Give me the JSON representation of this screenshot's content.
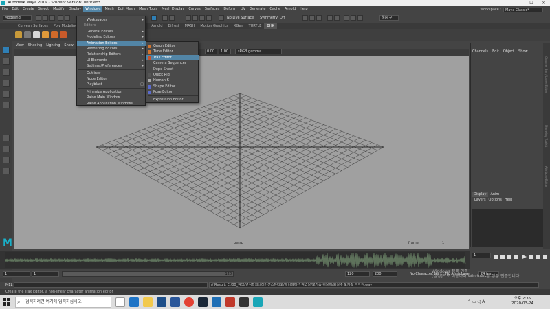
{
  "window": {
    "title": "Autodesk Maya 2019 - Student Version: untitled*",
    "buttons": [
      "—",
      "☐",
      "✕"
    ]
  },
  "menubar": {
    "items": [
      "File",
      "Edit",
      "Create",
      "Select",
      "Modify",
      "Display",
      "Windows",
      "Mesh",
      "Edit Mesh",
      "Mesh Tools",
      "Mesh Display",
      "Curves",
      "Surfaces",
      "Deform",
      "UV",
      "Generate",
      "Cache",
      "Arnold",
      "Help"
    ],
    "active": "Windows"
  },
  "workspace": {
    "label": "Workspace :",
    "value": "Maya Classic*"
  },
  "statusline": {
    "mode": "Modeling",
    "live_surface": "No Live Surface",
    "symmetry": "Symmetry: Off",
    "user": "해승 구"
  },
  "shelf": {
    "tabs": [
      "Curves / Surfaces",
      "Poly Modeling",
      "S",
      "g",
      "FX",
      "FX Caching",
      "Custom",
      "Arnold",
      "Bifrost",
      "MASH",
      "Motion Graphics",
      "XGen",
      "TURTLE",
      "BHK"
    ],
    "current": "BHK"
  },
  "viewport": {
    "menu": [
      "View",
      "Shading",
      "Lighting",
      "Show",
      "R"
    ],
    "gamma_values": [
      "0.00",
      "1.00"
    ],
    "color_space": "sRGB gamma",
    "camera_label": "persp",
    "frame_label": "frame",
    "frame_number": "1"
  },
  "channel_box": {
    "tabs": [
      "Channels",
      "Edit",
      "Object",
      "Show"
    ]
  },
  "layer_editor": {
    "tabs": [
      "Display",
      "Anim"
    ],
    "menu": [
      "Layers",
      "Options",
      "Help"
    ]
  },
  "side_labels": [
    "Channel Box / Layer Editor",
    "Modeling Toolkit",
    "Attribute Editor"
  ],
  "windows_menu": {
    "items": [
      {
        "label": "Workspaces",
        "submenu": true,
        "type": "item"
      },
      {
        "label": "Editors",
        "type": "header"
      },
      {
        "label": "General Editors",
        "submenu": true,
        "type": "item"
      },
      {
        "label": "Modeling Editors",
        "submenu": true,
        "type": "item"
      },
      {
        "label": "Animation Editors",
        "submenu": true,
        "type": "item",
        "highlight": true
      },
      {
        "label": "Rendering Editors",
        "submenu": true,
        "type": "item"
      },
      {
        "label": "Relationship Editors",
        "submenu": true,
        "type": "item"
      },
      {
        "label": "UI Elements",
        "submenu": true,
        "type": "item"
      },
      {
        "label": "Settings/Preferences",
        "submenu": true,
        "type": "item"
      },
      {
        "label": "Outliner",
        "type": "item"
      },
      {
        "label": "Node Editor",
        "type": "item"
      },
      {
        "label": "Playblast",
        "type": "item",
        "box": true
      },
      {
        "label": "Minimize Application",
        "type": "item"
      },
      {
        "label": "Raise Main Window",
        "type": "item"
      },
      {
        "label": "Raise Application Windows",
        "type": "item"
      }
    ]
  },
  "animation_editors_menu": {
    "items": [
      {
        "label": "Graph Editor",
        "icon_color": "#d2732d"
      },
      {
        "label": "Time Editor",
        "icon_color": "#d2732d"
      },
      {
        "label": "Trax Editor",
        "icon_color": "#c8502a",
        "highlight": true
      },
      {
        "label": "Camera Sequencer",
        "icon_color": ""
      },
      {
        "label": "Dope Sheet",
        "icon_color": ""
      },
      {
        "label": "Quick Rig",
        "icon_color": "#555555"
      },
      {
        "label": "HumanIK",
        "icon_color": "#aaaaaa"
      },
      {
        "label": "Shape Editor",
        "icon_color": "#5a6acc"
      },
      {
        "label": "Pose Editor",
        "icon_color": "#5a6acc"
      },
      {
        "label": "Expression Editor",
        "icon_color": ""
      }
    ]
  },
  "timeline": {
    "current_frame": "1"
  },
  "range": {
    "start": "1",
    "start2": "1",
    "slider_end": "120",
    "end": "120",
    "end2": "200",
    "character_set": "No Character Set",
    "anim_layer": "No Anim Layer",
    "fps": "24 fps"
  },
  "command_line": {
    "label": "MEL",
    "result": "// Result: E:/00_작업/연식학회나래이션스튜디오/애니메이션 작업물/보가솜 위물이/화실수 모가솜 ㅋㅋㅋ.wav"
  },
  "help_line": "Create the Trax Editor, a non-linear character animation editor",
  "watermark": {
    "line1": "Windows 정품 인증",
    "line2": "[설정]으로 이동하여 Windows를 정품 인증합니다."
  },
  "taskbar": {
    "search_placeholder": "검색하려면 여기에 입력하십시오.",
    "time": "오후 2:35",
    "date": "2020-03-24",
    "ime": "A"
  },
  "colors": {
    "accent": "#5285a6",
    "maya_logo": "#1ab0c8",
    "viewport_bg": "#a0a0a0"
  }
}
